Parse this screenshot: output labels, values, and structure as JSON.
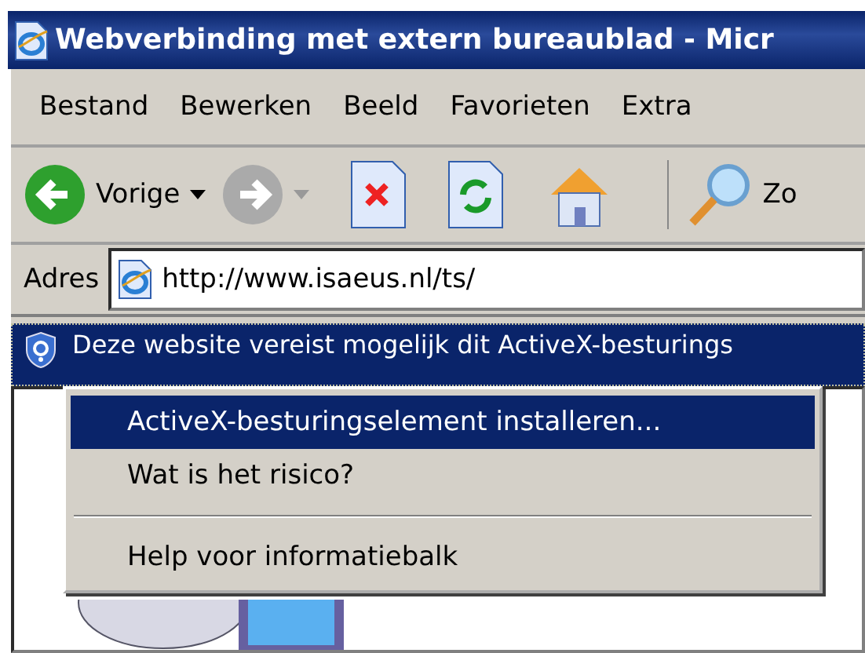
{
  "window": {
    "title": "Webverbinding met extern bureaublad - Micr"
  },
  "menu_bar": [
    "Bestand",
    "Bewerken",
    "Beeld",
    "Favorieten",
    "Extra"
  ],
  "toolbar": [
    {
      "kind": "back",
      "label": "Vorige",
      "disabled": false
    },
    {
      "kind": "forward",
      "disabled": true
    },
    {
      "kind": "stop"
    },
    {
      "kind": "refresh"
    },
    {
      "kind": "home"
    },
    {
      "kind": "search",
      "label": "Zo"
    }
  ],
  "address_bar": {
    "label": "Adres",
    "value": "http://www.isaeus.nl/ts/"
  },
  "info_bar": {
    "text": "Deze website vereist mogelijk dit ActiveX-besturings"
  },
  "context_menu": [
    {
      "kind": "item",
      "label": "ActiveX-besturingselement installeren...",
      "selected": true
    },
    {
      "kind": "item",
      "label": "Wat is het risico?",
      "selected": false
    },
    {
      "kind": "separator"
    },
    {
      "kind": "item",
      "label": "Help voor informatiebalk",
      "selected": false
    }
  ]
}
